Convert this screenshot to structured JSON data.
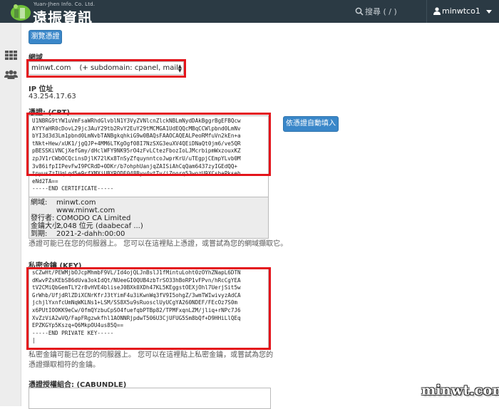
{
  "header": {
    "brand_small": "Yuan-Jhen Info. Co. Ltd.",
    "brand_name": "遠振資訊",
    "search_placeholder": "搜尋 ( / )",
    "username": "minwtco1"
  },
  "sidebar": {
    "icons": [
      "grid-icon",
      "users-icon"
    ]
  },
  "form": {
    "browse_button": "瀏覽憑證",
    "domain_label": "網域",
    "domain_value": "minwt.com",
    "domain_extra": "(+ subdomain: cpanel, mail, webdisk, v",
    "ip_label": "IP 位址",
    "ip_value": "43.254.17.63",
    "crt_label": "憑證: (CRT)",
    "autofill_button": "依憑證自動填入",
    "crt_lines": [
      "U1NBRG9tYW1uVmFsaWRhdGlvblN1Y3VyZVNlcnZlckNBLmNydDAkBggrBgEFBQcw",
      "AYYYaHR0cDovL29jc3AuY29tb2RvY2EuY29tMCMGA1UdEQQcMBqCCWlpbnd0LmNv",
      "bYI3d3d3Lm1pbnd0LmNvbTANBgkqhkiG9w0BAQsFAAOCAQEALPeoRMfuVn2kEn+a",
      "tNkt+Hew/xUK1/jgQJP+4MM6LTKgOgf08I7NzSXG3euXV4QEiDNaQt0jm6/ve5QR",
      "pBESSKiVNCjXefGmy/dHclWFY9NK95rO4zFvLCtezFbozIoLJMcrbipmWxzouxKZ",
      "zpJV1rCWbOCQcinsDjlK72lKx8TnSyZfquynntcoJwprKrU/uTEgpjCEmpYLvb0M",
      "3v86ifpIIPevFwI9PCRdD+0DKr/b7ohphUanjqZAISiAhCqQam6437zyIGEdQQ+",
      "tpyusZzIUqLqd5e9rfXMXiUBYRQDE048Byv4vtTv/iZnorq53wozU9XCsbaPkseh",
      "eNd2TA==",
      "-----END CERTIFICATE-----"
    ],
    "details": [
      {
        "key": "網域:",
        "value": "minwt.com"
      },
      {
        "key": "",
        "value": "www.minwt.com"
      },
      {
        "key": "發行者:",
        "value": "COMODO CA Limited"
      },
      {
        "key": "金鑰大小:",
        "value": "2,048 位元 (daabecaf ...)"
      },
      {
        "key": "到期:",
        "value": "2021-2-dahh:00:00"
      }
    ],
    "crt_note": "憑證可能已在您的伺服器上。 您可以在這裡貼上憑證，或嘗試為您的網域擷取它。",
    "key_label": "私密金鑰 (KEY)",
    "key_lines": [
      "sCZwHt/PEWMjbOJcpMhmbF9VL/Id4ojQLJnBslJ1fMintuLoht0zOYhZNapL6DTN",
      "dKwvPZsKEbS86dUva3okIdQt/NUeeGI0QUB4zbTrSO33hBoRP1vFPvn/hRcCgYEA",
      "tV2CMiQbGemTLY2r8vHVE4bliseJ0BXk0XDh47KL5KEggstOEXjOhl7UerjSit5w",
      "GrWhb/UfjdRlZDiXCNrKfrJ3tYimF4u3iKwnWq3fV9I5ohgZ/3wmTWIwivyzAdCA",
      "jchjlYxnfcUmNqWKLNs1+LSM/SS8X5u9sRuosclUyUCgYA260NDEF/FEcOz7S0m",
      "x6PUtIOOKK9eCw/0fmQYzbuCpSO4fuefqbPTBp82/TPMFxqnLZM/jliq+rNPc7J6",
      "XvZzViA2wVQ/FapFRgzwkfhl1AONNRjpdwT506U3CjUFUG5Sm8bQf+D9HHiLlQEq",
      "EPZKGYp5Kszq+Q6MkpOU4us85Q==",
      "-----END PRIVATE KEY-----",
      "|"
    ],
    "key_note": "私密金鑰可能已在您的伺服器上。 您可以在這裡貼上私密金鑰，或嘗試為您的憑證擷取相符的金鑰。",
    "cabundle_label": "憑證授權組合: (CABUNDLE)"
  },
  "watermark": "minwt.com",
  "colors": {
    "topbar": "#2b3a44",
    "button": "#3a87c9",
    "highlight": "#e4141b"
  }
}
